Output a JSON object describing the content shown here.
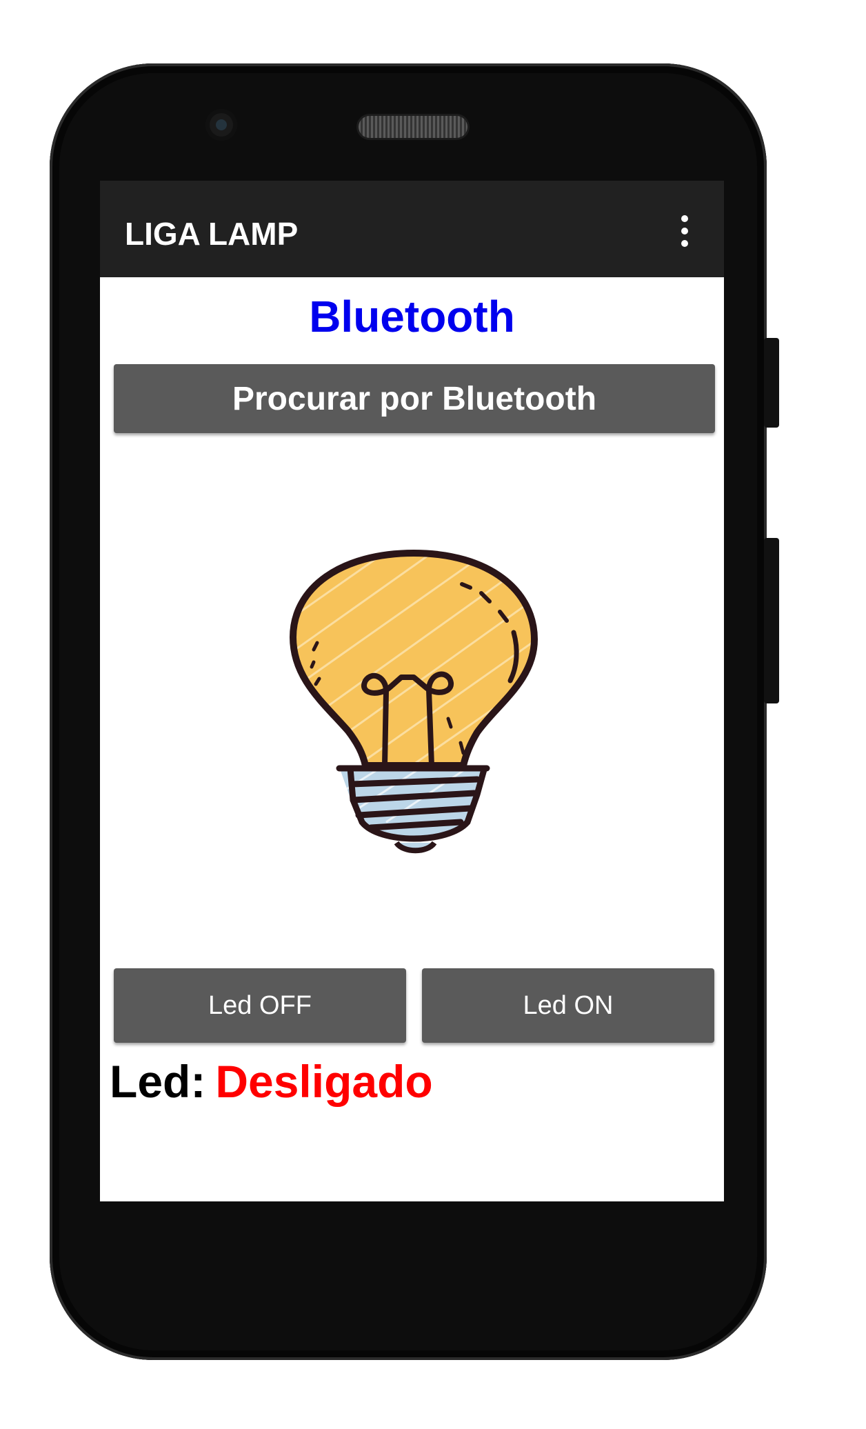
{
  "app": {
    "title": "LIGA LAMP"
  },
  "main": {
    "heading": "Bluetooth",
    "search_button": "Procurar por Bluetooth",
    "led_off_button": "Led OFF",
    "led_on_button": "Led ON"
  },
  "status": {
    "label": "Led:",
    "value": "Desligado"
  },
  "colors": {
    "appbar": "#212121",
    "heading": "#0000ee",
    "button": "#5a5a5a",
    "status_value": "#ff0000",
    "bulb_glass": "#f7c35a",
    "bulb_base": "#bcd6e8"
  },
  "icons": {
    "overflow_menu": "more-vert-icon",
    "illustration": "lightbulb-icon"
  }
}
